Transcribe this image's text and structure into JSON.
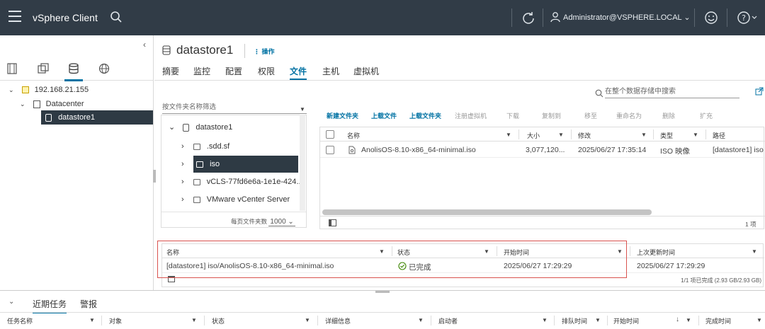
{
  "header": {
    "app_title": "vSphere Client",
    "user": "Administrator@VSPHERE.LOCAL"
  },
  "sidebar": {
    "tree": [
      {
        "label": "192.168.21.155",
        "level": 0
      },
      {
        "label": "Datacenter",
        "level": 1
      },
      {
        "label": "datastore1",
        "level": 2,
        "selected": true
      }
    ]
  },
  "main": {
    "title": "datastore1",
    "actions_label": "操作",
    "tabs": [
      "摘要",
      "监控",
      "配置",
      "权限",
      "文件",
      "主机",
      "虚拟机"
    ],
    "active_tab": "文件",
    "search_placeholder": "在整个数据存储中搜索",
    "folder_filter_placeholder": "按文件夹名称筛选",
    "folder_tree": [
      {
        "label": "datastore1",
        "level": 0,
        "expanded": true
      },
      {
        "label": ".sdd.sf",
        "level": 1
      },
      {
        "label": "iso",
        "level": 1,
        "selected": true
      },
      {
        "label": "vCLS-77fd6e6a-1e1e-424...",
        "level": 1
      },
      {
        "label": "VMware vCenter Server",
        "level": 1
      }
    ],
    "folders_per_page_label": "每页文件夹数",
    "folders_per_page_value": "1000",
    "toolbar": [
      {
        "label": "新建文件夹",
        "enabled": true
      },
      {
        "label": "上载文件",
        "enabled": true
      },
      {
        "label": "上载文件夹",
        "enabled": true
      },
      {
        "label": "注册虚拟机",
        "enabled": false
      },
      {
        "label": "下载",
        "enabled": false
      },
      {
        "label": "复制到",
        "enabled": false
      },
      {
        "label": "移至",
        "enabled": false
      },
      {
        "label": "重命名为",
        "enabled": false
      },
      {
        "label": "删除",
        "enabled": false
      },
      {
        "label": "扩充",
        "enabled": false
      }
    ],
    "file_grid": {
      "columns": [
        "名称",
        "大小",
        "修改",
        "类型",
        "路径"
      ],
      "rows": [
        {
          "name": "AnolisOS-8.10-x86_64-minimal.iso",
          "size": "3,077,120...",
          "modified": "2025/06/27 17:35:14",
          "type": "ISO 映像",
          "path": "[datastore1] iso"
        }
      ],
      "count": "1 项"
    },
    "upload_grid": {
      "columns": [
        "名称",
        "状态",
        "开始时间",
        "上次更新时间"
      ],
      "row": {
        "name": "[datastore1] iso/AnolisOS-8.10-x86_64-minimal.iso",
        "status": "已完成",
        "start": "2025/06/27 17:29:29",
        "updated": "2025/06/27 17:29:29"
      },
      "footer": "1/1 项已完成 (2.93 GB/2.93 GB)"
    }
  },
  "bottom": {
    "tabs": [
      "近期任务",
      "警报"
    ],
    "active_tab": "近期任务",
    "columns": [
      "任务名称",
      "对象",
      "状态",
      "详细信息",
      "启动者",
      "排队时间",
      "开始时间",
      "完成时间"
    ]
  },
  "colors": {
    "header_bg": "#313c47",
    "accent": "#0072a3",
    "highlight_box": "#d9534f",
    "success": "#3c8500"
  }
}
